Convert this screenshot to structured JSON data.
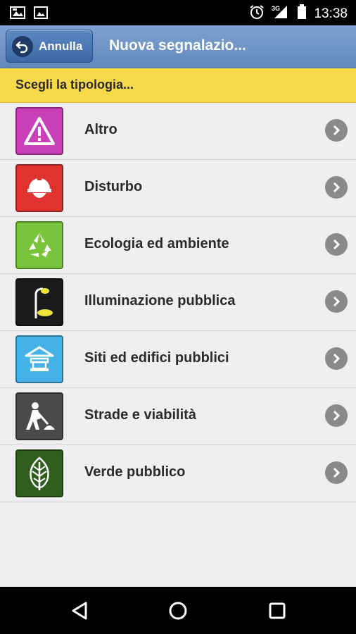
{
  "status_bar": {
    "time": "13:38",
    "network": "3G",
    "icons": [
      "gallery-icon",
      "image-icon",
      "alarm-icon",
      "signal-icon",
      "battery-icon"
    ]
  },
  "header": {
    "back_label": "Annulla",
    "title": "Nuova segnalazio..."
  },
  "section": {
    "label": "Scegli la tipologia..."
  },
  "categories": [
    {
      "label": "Altro",
      "icon": "warning-icon",
      "color": "#c940b8"
    },
    {
      "label": "Disturbo",
      "icon": "helmet-icon",
      "color": "#e0332f"
    },
    {
      "label": "Ecologia ed ambiente",
      "icon": "recycle-icon",
      "color": "#79c43a"
    },
    {
      "label": "Illuminazione pubblica",
      "icon": "street-lamp-icon",
      "color": "#1a1a1a"
    },
    {
      "label": "Siti ed edifici pubblici",
      "icon": "public-building-icon",
      "color": "#46b3e8"
    },
    {
      "label": "Strade e viabilità",
      "icon": "roadwork-icon",
      "color": "#4a4a4a"
    },
    {
      "label": "Verde pubblico",
      "icon": "leaf-icon",
      "color": "#2f5d1e"
    }
  ],
  "navigation": {
    "buttons": [
      "back-nav-icon",
      "home-nav-icon",
      "recents-nav-icon"
    ]
  }
}
